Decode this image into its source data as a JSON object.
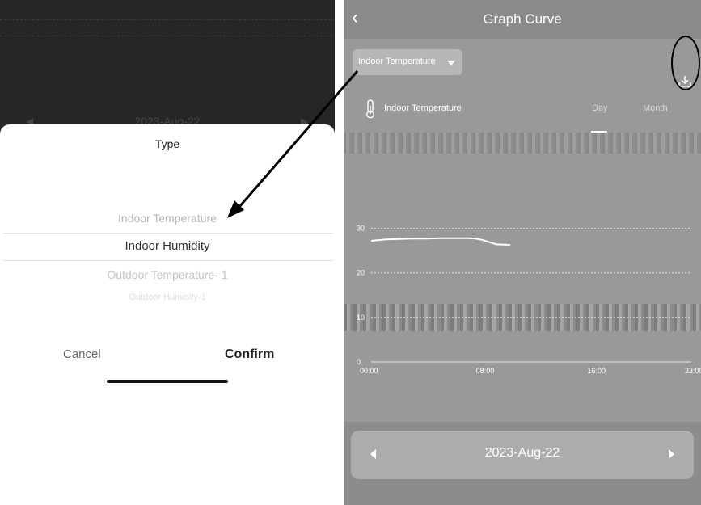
{
  "left_panel": {
    "background_chart": {
      "date": "2023-Aug-22"
    },
    "picker": {
      "title": "Type",
      "options": [
        "Indoor Temperature",
        "Indoor Humidity",
        "Outdoor Temperature- 1",
        "Outdoor Humidity-1"
      ],
      "selected": "Indoor Humidity",
      "cancel_label": "Cancel",
      "confirm_label": "Confirm"
    }
  },
  "right_panel": {
    "header": {
      "title": "Graph Curve",
      "back_icon": "chevron-left-icon"
    },
    "dropdown": {
      "label": "Indoor Temperature",
      "icon": "caret-down-icon"
    },
    "download_icon": "download-icon",
    "series_row": {
      "icon": "thermometer-icon",
      "label": "Indoor Temperature",
      "tabs": [
        "Day",
        "Month"
      ],
      "active_tab": "Day"
    },
    "footer": {
      "date": "2023-Aug-22",
      "prev_icon": "triangle-left-icon",
      "next_icon": "triangle-right-icon"
    }
  },
  "chart_data": {
    "type": "line",
    "title": "",
    "xlabel": "",
    "ylabel": "",
    "x_ticks": [
      "00:00",
      "08:00",
      "16:00",
      "23:00"
    ],
    "y_ticks": [
      "0",
      "10",
      "20",
      "30"
    ],
    "ylim": [
      0,
      35
    ],
    "xlim": [
      0,
      23
    ],
    "grid": true,
    "series": [
      {
        "x": [
          0,
          1,
          2,
          3,
          4,
          5,
          6,
          7,
          7.5,
          8,
          8.5,
          9,
          10
        ],
        "y": [
          27.2,
          27.5,
          27.6,
          27.7,
          27.7,
          27.8,
          27.8,
          27.8,
          27.7,
          27.4,
          26.9,
          26.4,
          26.3
        ]
      }
    ],
    "colors": {
      "line": "#ffffff",
      "grid": "#e8e8e8",
      "background": "#999999"
    }
  }
}
